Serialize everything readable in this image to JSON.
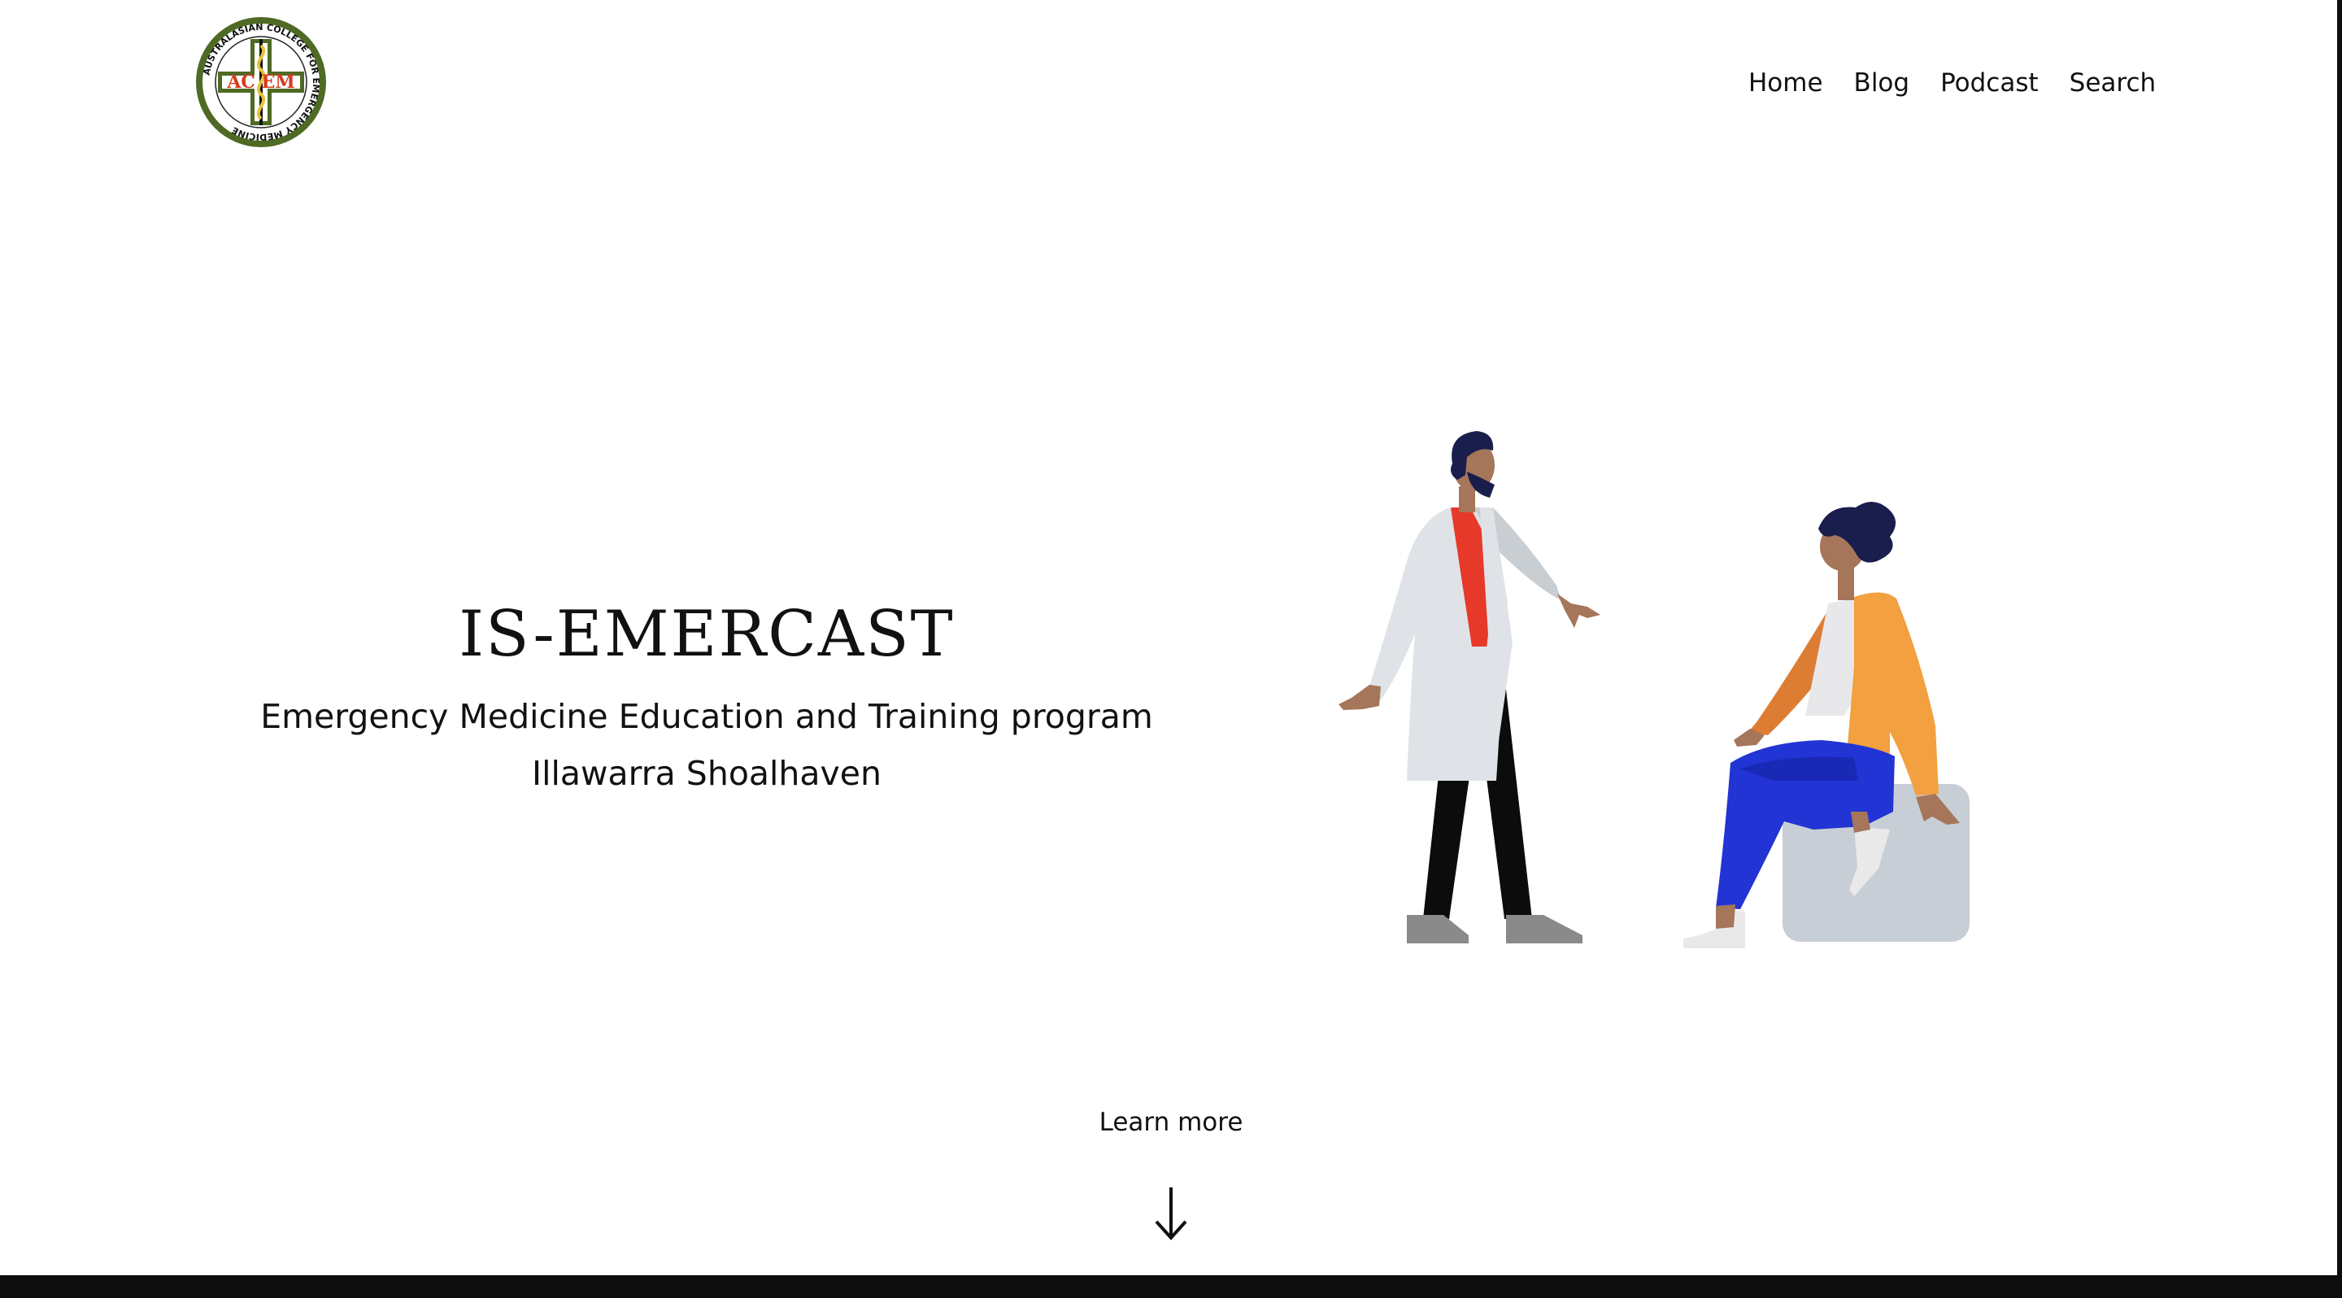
{
  "logo": {
    "letters": "AC EM",
    "ring_text": "AUSTRALASIAN COLLEGE FOR EMERGENCY MEDICINE",
    "colors": {
      "ring": "#4f6a24",
      "letters": "#d73a1e",
      "cross": "#4f6a24"
    }
  },
  "nav": {
    "items": [
      {
        "label": "Home"
      },
      {
        "label": "Blog"
      },
      {
        "label": "Podcast"
      },
      {
        "label": "Search"
      }
    ]
  },
  "hero": {
    "title": "IS-EMERCAST",
    "subtitle_line1": "Emergency Medicine Education and Training program",
    "subtitle_line2": "Illawarra Shoalhaven"
  },
  "cta": {
    "learn_more": "Learn more",
    "arrow_icon": "arrow-down-icon"
  },
  "colors": {
    "coat": "#dfe3e7",
    "shirt": "#e6392a",
    "pants_dark": "#0c0c0c",
    "jacket": "#f2a040",
    "jeans": "#2234d4",
    "seat": "#c7ced6",
    "skin": "#a5765a",
    "hair": "#1a1e4d"
  }
}
